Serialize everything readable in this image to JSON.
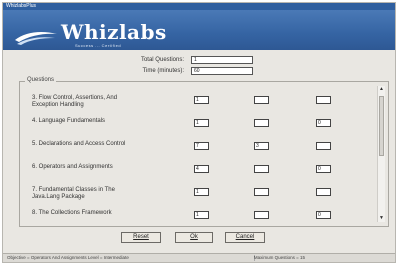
{
  "window": {
    "title": "WhizlabsPlus"
  },
  "brand": {
    "logo_text": "Whizlabs",
    "tagline": "Success ... Certified"
  },
  "meta": {
    "total_questions_label": "Total Questions:",
    "total_questions_value": "1",
    "time_label": "Time (minutes):",
    "time_value": "60"
  },
  "questions": {
    "legend": "Questions",
    "rows": [
      {
        "label": "3. Flow Control, Assertions, And Exception Handling",
        "values": [
          "1",
          "",
          ""
        ]
      },
      {
        "label": "4. Language Fundamentals",
        "values": [
          "1",
          "",
          "0"
        ]
      },
      {
        "label": "5. Declarations and Access Control",
        "values": [
          "7",
          "3",
          ""
        ]
      },
      {
        "label": "6. Operators and Assignments",
        "values": [
          "4",
          "",
          "0"
        ]
      },
      {
        "label": "7. Fundamental Classes in The Java.Lang Package",
        "values": [
          "1",
          "",
          ""
        ]
      },
      {
        "label": "8. The Collections Framework",
        "values": [
          "1",
          "",
          "0"
        ]
      }
    ]
  },
  "buttons": {
    "reset": "Reset",
    "ok": "Ok",
    "cancel": "Cancel"
  },
  "status": {
    "left": "Objective = Operators And Assignments  Level = Intermediate",
    "right": "Maximum Questions = 15"
  }
}
